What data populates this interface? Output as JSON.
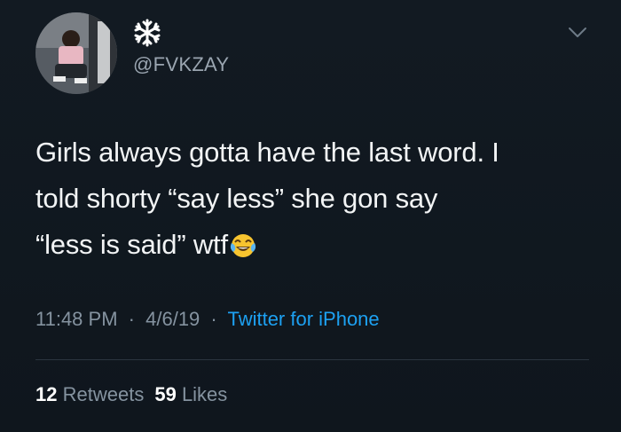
{
  "tweet": {
    "handle": "@FVKZAY",
    "display_name_icon": "snowflake-icon",
    "text_lines": [
      "Girls always gotta have the last word. I",
      "told shorty “say less” she gon say",
      "“less is said” wtf"
    ],
    "emoji": "face-with-tears-of-joy",
    "time": "11:48 PM",
    "date": "4/6/19",
    "separator": "·",
    "source": "Twitter for iPhone",
    "retweets_count": "12",
    "retweets_label": "Retweets",
    "likes_count": "59",
    "likes_label": "Likes"
  },
  "colors": {
    "background": "#10171e",
    "text": "#f2f4f5",
    "muted": "#8593a0",
    "link": "#1da1f2"
  }
}
